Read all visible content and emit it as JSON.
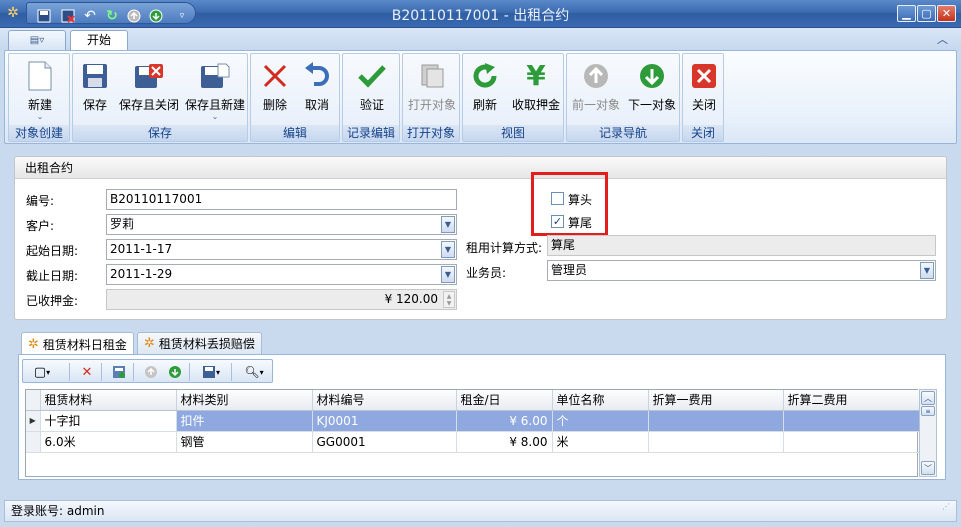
{
  "window": {
    "title": "B20110117001 - 出租合约"
  },
  "quick_access": [
    "save-icon",
    "save-close-icon",
    "undo-icon",
    "refresh-icon",
    "nav-up-icon",
    "nav-down-icon",
    "customize-icon"
  ],
  "ribbon": {
    "tabs": {
      "menu": "",
      "start": "开始"
    },
    "groups": [
      {
        "title": "对象创建",
        "buttons": [
          {
            "label": "新建",
            "icon": "new-icon"
          }
        ]
      },
      {
        "title": "保存",
        "buttons": [
          {
            "label": "保存"
          },
          {
            "label": "保存且关闭"
          },
          {
            "label": "保存且新建"
          }
        ]
      },
      {
        "title": "编辑",
        "buttons": [
          {
            "label": "删除"
          },
          {
            "label": "取消"
          }
        ]
      },
      {
        "title": "记录编辑",
        "buttons": [
          {
            "label": "验证"
          }
        ]
      },
      {
        "title": "打开对象",
        "buttons": [
          {
            "label": "打开对象"
          }
        ]
      },
      {
        "title": "视图",
        "buttons": [
          {
            "label": "刷新"
          },
          {
            "label": "收取押金"
          }
        ]
      },
      {
        "title": "记录导航",
        "buttons": [
          {
            "label": "前一对象"
          },
          {
            "label": "下一对象"
          }
        ]
      },
      {
        "title": "关闭",
        "buttons": [
          {
            "label": "关闭"
          }
        ]
      }
    ]
  },
  "form": {
    "title": "出租合约",
    "labels": {
      "code": "编号:",
      "customer": "客户:",
      "start_date": "起始日期:",
      "end_date": "截止日期:",
      "deposit": "已收押金:",
      "calc_mode": "租用计算方式:",
      "salesman": "业务员:"
    },
    "values": {
      "code": "B20110117001",
      "customer": "罗莉",
      "start_date": "2011-1-17",
      "end_date": "2011-1-29",
      "deposit": "¥ 120.00",
      "calc_mode": "算尾",
      "salesman": "管理员"
    },
    "checkboxes": {
      "count_head": {
        "label": "算头",
        "checked": false
      },
      "count_tail": {
        "label": "算尾",
        "checked": true
      }
    }
  },
  "detail_tabs": [
    "租赁材料日租金",
    "租赁材料丢损赔偿"
  ],
  "grid": {
    "columns": [
      "租赁材料",
      "材料类别",
      "材料编号",
      "租金/日",
      "单位名称",
      "折算一费用",
      "折算二费用"
    ],
    "rows": [
      [
        "十字扣",
        "扣件",
        "KJ0001",
        "¥ 6.00",
        "个",
        "",
        ""
      ],
      [
        "6.0米",
        "钢管",
        "GG0001",
        "¥ 8.00",
        "米",
        "",
        ""
      ]
    ]
  },
  "status": {
    "text": "登录账号: admin"
  }
}
